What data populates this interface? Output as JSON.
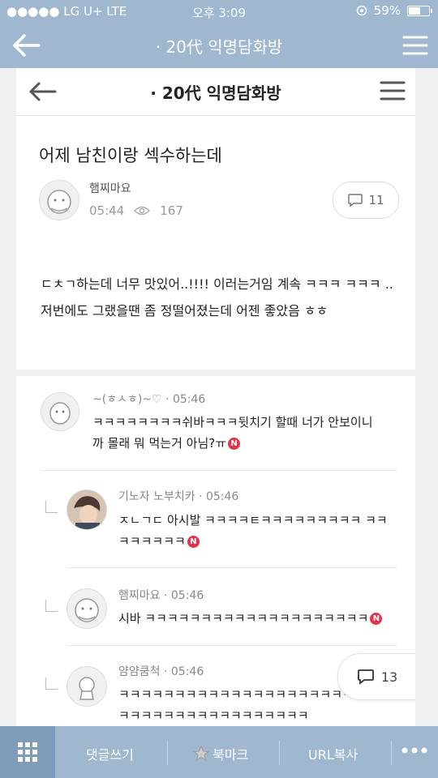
{
  "status_bar": {
    "carrier": "●●●●● LG U+  LTE",
    "time": "오후 3:09",
    "battery": "59%",
    "battery_level": 0.59
  },
  "outer_nav": {
    "title": "· 20代 익명담화방",
    "back_icon": "back-arrow-icon",
    "menu_icon": "hamburger-menu-icon"
  },
  "inner_nav": {
    "title": "· 20代 익명담화방",
    "back_icon": "back-arrow-icon",
    "menu_icon": "hamburger-menu-icon"
  },
  "post": {
    "title": "어제 남친이랑 섹수하는데",
    "author": "햄찌마요",
    "time": "05:44",
    "views": "167",
    "comment_count": "11",
    "body": "ㄷㅊㄱ하는데 너무 맛있어..!!!! 이러는거임 계속 ㅋㅋㅋ ㅋㅋㅋ .. 저번에도 그랬을땐 좀 정떨어졌는데 어젠 좋았음 ㅎㅎ"
  },
  "comments": [
    {
      "name": "~(ㅎㅅㅎ)~♡",
      "time": "05:46",
      "text": "ㅋㅋㅋㅋㅋㅋㅋㅋ쉬바ㅋㅋㅋ뒷치기 할때 너가 안보이니까 몰래 뭐 먹는거 아님?ㅠ",
      "badge": "N",
      "reply": false
    },
    {
      "name": "기노자 노부치카",
      "time": "05:46",
      "text": "ㅈㄴㄱㄷ 아시발 ㅋㅋㅋㅋㅌㅋㅋㅋㅋㅋㅋㅋㅋㅋ ㅋㅋㅋㅋㅋㅋㅋㅋ",
      "badge": "N",
      "reply": true
    },
    {
      "name": "햄찌마요",
      "time": "05:46",
      "text": "시바 ㅋㅋㅋㅋㅋㅋㅋㅋㅋㅋㅋㅋㅋㅋㅋㅋㅋㅋㅋㅋ",
      "badge": "N",
      "reply": true
    },
    {
      "name": "얌얌쿰척",
      "time": "05:46",
      "text": "ㅋㅋㅋㅋㅋㅋㅋㅋㅋㅋㅋㅋㅋㅋㅋㅋㅋㅋㅋㅋㅋ ㅋㅋㅋㅋㅋㅋㅋㅋㅋㅋㅋㅋㅋㅋㅋㅋㅋㅋㅋㅋㅋ",
      "badge": "",
      "reply": true
    }
  ],
  "floating_comments": {
    "count": "13",
    "icon": "comment-bubble-icon"
  },
  "bottom_bar": {
    "grid_icon": "grid-menu-icon",
    "write_comment": "댓글쓰기",
    "bookmark": "북마크",
    "bookmark_icon": "star-icon",
    "copy_url": "URL복사",
    "more_icon": "more-dots-icon"
  }
}
